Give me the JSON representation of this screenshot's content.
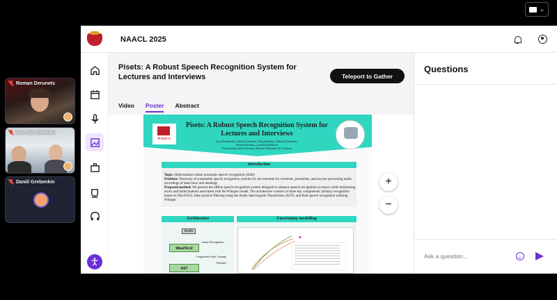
{
  "participants": [
    {
      "name": "Roman Derunets"
    },
    {
      "name": "Ivan Bondarenko"
    },
    {
      "name": "Daniil Grebenkin"
    }
  ],
  "header": {
    "brand": "NAACL 2025"
  },
  "paper": {
    "title": "Pisets: A Robust Speech Recognition System for Lectures and Interviews",
    "teleport_label": "Teleport to Gather",
    "tabs": [
      {
        "label": "Video",
        "active": false
      },
      {
        "label": "Poster",
        "active": true
      },
      {
        "label": "Abstract",
        "active": false
      }
    ]
  },
  "poster": {
    "logo_text": "NAACL",
    "title": "Pisets: A Robust Speech Recognition System for Lectures and Interviews",
    "authors": "Ivan Bondarenko, Daniil Grebenkin, Oleg Sedukhin, Mikhail Klementev",
    "authors2": "Roman Derunets, Lyudmila Budneva",
    "affiliation": "Novosibirsk State University, Siberian Neuronets LLC, Russia",
    "intro_heading": "Introduction",
    "topic_label": "Topic:",
    "topic": "Hallucination robust automatic speech recognition (ASR)",
    "problem_label": "Problem:",
    "problem": "Necessity of sustainable speech recognition systems for are essential for scientists, journalists, and anyone processing audio recordings of interviews and meetings",
    "method_label": "Proposed method:",
    "method": "We present the offline speech recognition system designed to enhance speech recognition accuracy while minimizing errors and hallucinations associated with the Whisper model. The architecture consists of three key components: primary recognition based on Wav2Vec2, false positive filtering using the Audio Spectrogram Transformer (AST), and final speech recognition utilizing Whisper.",
    "arch_heading": "Architecture",
    "uncert_heading": "Uncertainty modelling",
    "blocks": {
      "audio": "Audio",
      "wav2vec": "Wav2Vec2",
      "ast": "AST",
      "initial": "Initial Recognition",
      "fragments": "Fragments With Timings",
      "filtration": "Filtration"
    }
  },
  "zoom": {
    "in": "+",
    "out": "−"
  },
  "questions": {
    "title": "Questions",
    "placeholder": "Ask a question..."
  },
  "colors": {
    "accent": "#6a2fd6",
    "poster_teal": "#2fd6c0",
    "brand_red": "#c0202b"
  }
}
